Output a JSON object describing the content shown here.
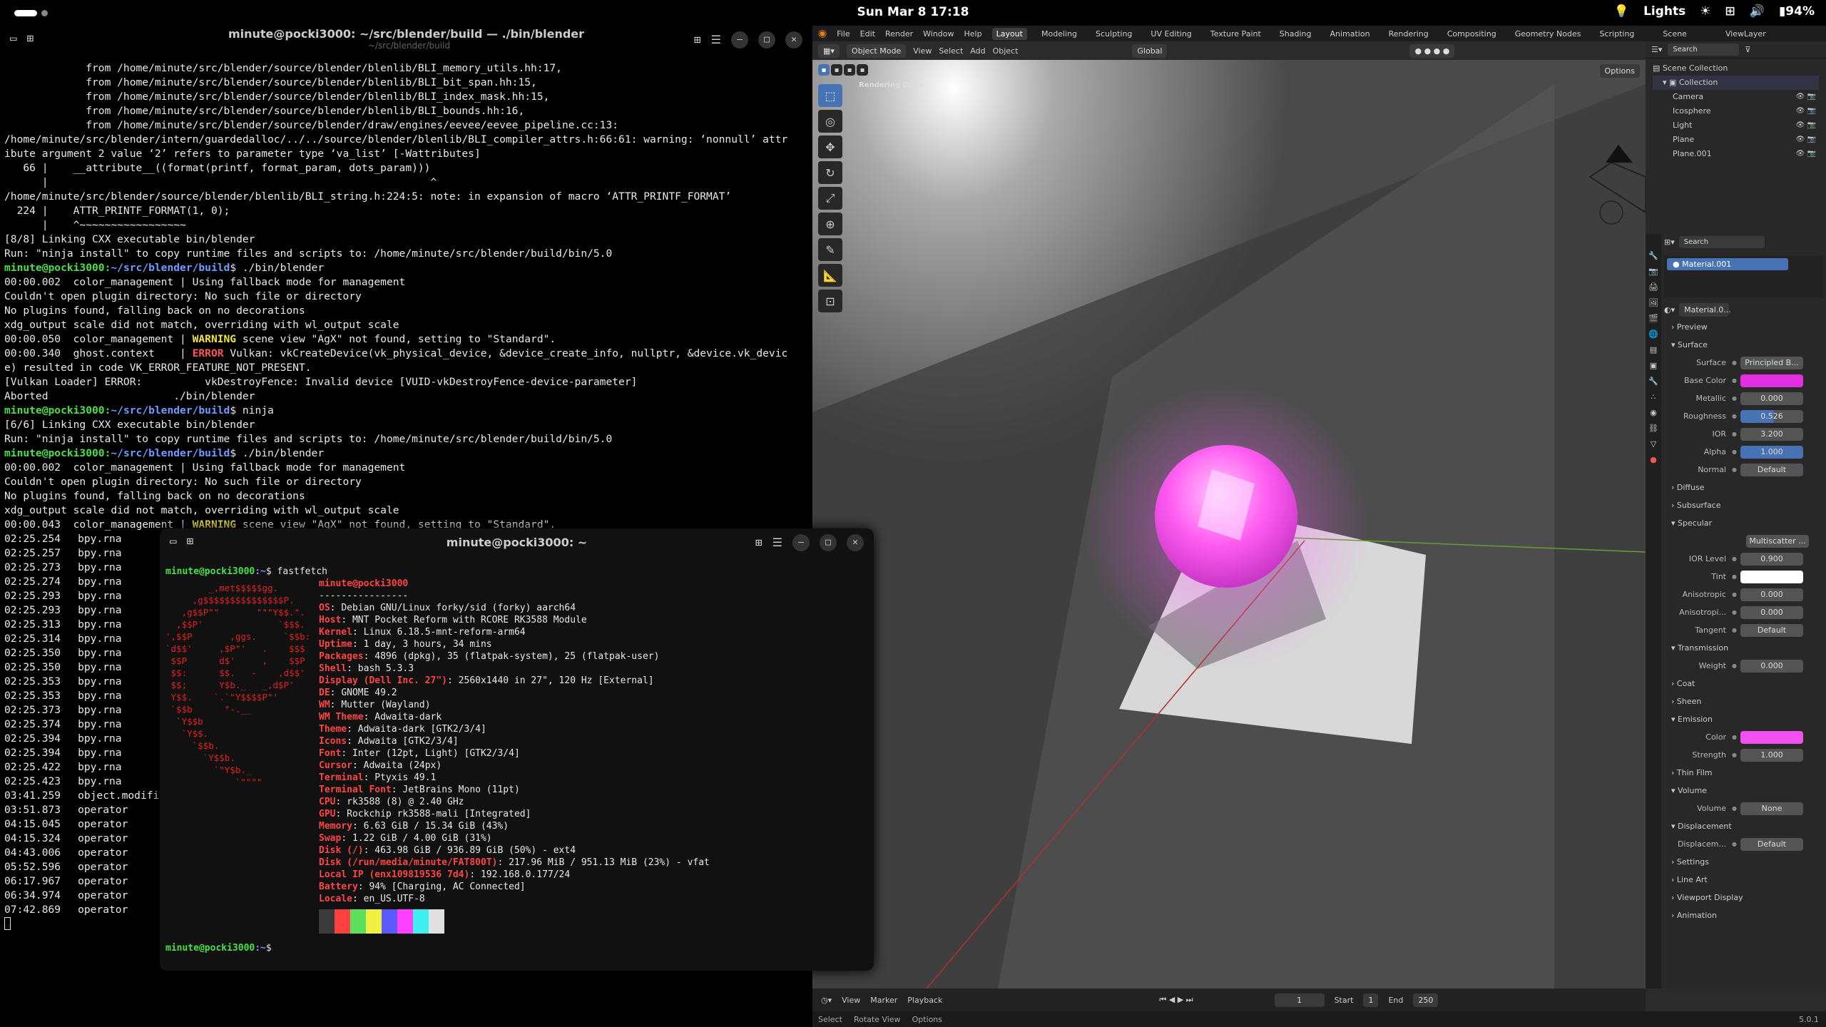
{
  "topbar": {
    "clock": "Sun Mar 8  17:18",
    "lights": "Lights",
    "battery": "94%"
  },
  "back_terminal": {
    "title": "minute@pocki3000: ~/src/blender/build — ./bin/blender",
    "subtitle": "~/src/blender/build",
    "lines": [
      "             from /home/minute/src/blender/source/blender/blenlib/BLI_memory_utils.hh:17,",
      "             from /home/minute/src/blender/source/blender/blenlib/BLI_bit_span.hh:15,",
      "             from /home/minute/src/blender/source/blender/blenlib/BLI_index_mask.hh:15,",
      "             from /home/minute/src/blender/source/blender/blenlib/BLI_bounds.hh:16,",
      "             from /home/minute/src/blender/source/blender/draw/engines/eevee/eevee_pipeline.cc:13:",
      "/home/minute/src/blender/intern/guardedalloc/../../source/blender/blenlib/BLI_compiler_attrs.h:66:61: warning: ‘nonnull’ attr",
      "ibute argument 2 value ‘2’ refers to parameter type ‘va_list’ [-Wattributes]",
      "   66 |    __attribute__((format(printf, format_param, dots_param)))",
      "      |                                                             ^",
      "/home/minute/src/blender/source/blender/blenlib/BLI_string.h:224:5: note: in expansion of macro ‘ATTR_PRINTF_FORMAT’",
      "  224 |    ATTR_PRINTF_FORMAT(1, 0);",
      "      |    ^~~~~~~~~~~~~~~~~~",
      "[8/8] Linking CXX executable bin/blender",
      "Run: \"ninja install\" to copy runtime files and scripts to: /home/minute/src/blender/build/bin/5.0"
    ],
    "session": [
      {
        "t": "prompt",
        "user": "minute@pocki3000",
        "path": "~/src/blender/build",
        "cmd": "$ ./bin/blender"
      },
      {
        "t": "line",
        "text": "00:00.002  color_management | Using fallback mode for management"
      },
      {
        "t": "line",
        "text": "Couldn't open plugin directory: No such file or directory"
      },
      {
        "t": "line",
        "text": "No plugins found, falling back on no decorations"
      },
      {
        "t": "line",
        "text": "xdg_output scale did not match, overriding with wl_output scale"
      },
      {
        "t": "tag",
        "pre": "00:00.050  color_management | ",
        "tag": "WARNING",
        "cls": "ylw",
        "post": " scene view \"AgX\" not found, setting to \"Standard\"."
      },
      {
        "t": "tag",
        "pre": "00:00.340  ghost.context    | ",
        "tag": "ERROR",
        "cls": "red",
        "post": " Vulkan: vkCreateDevice(vk_physical_device, &device_create_info, nullptr, &device.vk_devic"
      },
      {
        "t": "line",
        "text": "e) resulted in code VK_ERROR_FEATURE_NOT_PRESENT."
      },
      {
        "t": "line",
        "text": "[Vulkan Loader] ERROR:          vkDestroyFence: Invalid device [VUID-vkDestroyFence-device-parameter]"
      },
      {
        "t": "line",
        "text": "Aborted                    ./bin/blender"
      },
      {
        "t": "prompt",
        "user": "minute@pocki3000",
        "path": "~/src/blender/build",
        "cmd": "$ ninja"
      },
      {
        "t": "line",
        "text": "[6/6] Linking CXX executable bin/blender"
      },
      {
        "t": "line",
        "text": "Run: \"ninja install\" to copy runtime files and scripts to: /home/minute/src/blender/build/bin/5.0"
      },
      {
        "t": "prompt",
        "user": "minute@pocki3000",
        "path": "~/src/blender/build",
        "cmd": "$ ./bin/blender"
      },
      {
        "t": "line",
        "text": "00:00.002  color_management | Using fallback mode for management"
      },
      {
        "t": "line",
        "text": "Couldn't open plugin directory: No such file or directory"
      },
      {
        "t": "line",
        "text": "No plugins found, falling back on no decorations"
      },
      {
        "t": "line",
        "text": "xdg_output scale did not match, overriding with wl_output scale"
      },
      {
        "t": "tag",
        "pre": "00:00.043  color_management | ",
        "tag": "WARNING",
        "cls": "ylw",
        "post": " scene view \"AgX\" not found, setting to \"Standard\"."
      }
    ],
    "log": [
      [
        "02:25.254",
        "bpy.rna"
      ],
      [
        "02:25.257",
        "bpy.rna"
      ],
      [
        "02:25.273",
        "bpy.rna"
      ],
      [
        "02:25.274",
        "bpy.rna"
      ],
      [
        "02:25.293",
        "bpy.rna"
      ],
      [
        "02:25.293",
        "bpy.rna"
      ],
      [
        "02:25.313",
        "bpy.rna"
      ],
      [
        "02:25.314",
        "bpy.rna"
      ],
      [
        "02:25.350",
        "bpy.rna"
      ],
      [
        "02:25.350",
        "bpy.rna"
      ],
      [
        "02:25.353",
        "bpy.rna"
      ],
      [
        "02:25.353",
        "bpy.rna"
      ],
      [
        "02:25.373",
        "bpy.rna"
      ],
      [
        "02:25.374",
        "bpy.rna"
      ],
      [
        "02:25.394",
        "bpy.rna"
      ],
      [
        "02:25.394",
        "bpy.rna"
      ],
      [
        "02:25.422",
        "bpy.rna"
      ],
      [
        "02:25.423",
        "bpy.rna"
      ],
      [
        "03:41.259",
        "object.modific"
      ],
      [
        "03:51.873",
        "operator"
      ],
      [
        "04:15.045",
        "operator"
      ],
      [
        "04:15.324",
        "operator"
      ],
      [
        "04:43.006",
        "operator"
      ],
      [
        "05:52.596",
        "operator"
      ],
      [
        "06:17.967",
        "operator"
      ],
      [
        "06:34.974",
        "operator"
      ],
      [
        "07:42.869",
        "operator"
      ]
    ]
  },
  "front_terminal": {
    "title": "minute@pocki3000: ~",
    "prompt_user": "minute@pocki3000",
    "prompt_path": ":~",
    "cmd": "$ fastfetch",
    "header": "minute@pocki3000",
    "sep": "----------------",
    "logo": [
      "        _,met$$$$$gg.",
      "     ,g$$$$$$$$$$$$$$$P.",
      "   ,g$$P\"\"       \"\"\"Y$$.\".",
      "  ,$$P'              `$$$.",
      "',$$P       ,ggs.     `$$b:",
      "`d$$'     ,$P\"'   .    $$$",
      " $$P      d$'     ,    $$P",
      " $$:      $$.   -    ,d$$'",
      " $$;      Y$b._   _,d$P'",
      " Y$$.    `.`\"Y$$$$P\"'",
      " `$$b      \"-.__",
      "  `Y$$b",
      "   `Y$$.",
      "     `$$b.",
      "       `Y$$b.",
      "         `\"Y$b._",
      "             `\"\"\"\""
    ],
    "info": [
      {
        "k": "OS",
        "v": "Debian GNU/Linux forky/sid (forky) aarch64"
      },
      {
        "k": "Host",
        "v": "MNT Pocket Reform with RCORE RK3588 Module"
      },
      {
        "k": "Kernel",
        "v": "Linux 6.18.5-mnt-reform-arm64"
      },
      {
        "k": "Uptime",
        "v": "1 day, 3 hours, 34 mins"
      },
      {
        "k": "Packages",
        "v": "4896 (dpkg), 35 (flatpak-system), 25 (flatpak-user)"
      },
      {
        "k": "Shell",
        "v": "bash 5.3.3"
      },
      {
        "k": "Display (Dell Inc. 27\")",
        "v": "2560x1440 in 27\", 120 Hz [External]"
      },
      {
        "k": "DE",
        "v": "GNOME 49.2"
      },
      {
        "k": "WM",
        "v": "Mutter (Wayland)"
      },
      {
        "k": "WM Theme",
        "v": "Adwaita-dark"
      },
      {
        "k": "Theme",
        "v": "Adwaita-dark [GTK2/3/4]"
      },
      {
        "k": "Icons",
        "v": "Adwaita [GTK2/3/4]"
      },
      {
        "k": "Font",
        "v": "Inter (12pt, Light) [GTK2/3/4]"
      },
      {
        "k": "Cursor",
        "v": "Adwaita (24px)"
      },
      {
        "k": "Terminal",
        "v": "Ptyxis 49.1"
      },
      {
        "k": "Terminal Font",
        "v": "JetBrains Mono (11pt)"
      },
      {
        "k": "CPU",
        "v": "rk3588 (8) @ 2.40 GHz"
      },
      {
        "k": "GPU",
        "v": "Rockchip rk3588-mali [Integrated]"
      },
      {
        "k": "Memory",
        "v": "6.63 GiB / 15.34 GiB (43%)"
      },
      {
        "k": "Swap",
        "v": "1.22 GiB / 4.00 GiB (31%)"
      },
      {
        "k": "Disk (/)",
        "v": "463.98 GiB / 936.89 GiB (50%) - ext4"
      },
      {
        "k": "Disk (/run/media/minute/FAT800T)",
        "v": "217.96 MiB / 951.13 MiB (23%) - vfat"
      },
      {
        "k": "Local IP (enx109819536 7d4)",
        "v": "192.168.0.177/24"
      },
      {
        "k": "Battery",
        "v": "94% [Charging, AC Connected]"
      },
      {
        "k": "Locale",
        "v": "en_US.UTF-8"
      }
    ],
    "palette": [
      "#3a3a3a",
      "#ff4040",
      "#5ee05e",
      "#f0f040",
      "#5a5aff",
      "#ff40ff",
      "#40f0f0",
      "#e0e0e0"
    ],
    "end_prompt": "$"
  },
  "blender": {
    "menu": [
      "File",
      "Edit",
      "Render",
      "Window",
      "Help"
    ],
    "workspaces": [
      "Layout",
      "Modeling",
      "Sculpting",
      "UV Editing",
      "Texture Paint",
      "Shading",
      "Animation",
      "Rendering",
      "Compositing",
      "Geometry Nodes",
      "Scripting"
    ],
    "scene": "Scene",
    "viewlayer": "ViewLayer",
    "vp_header": {
      "mode": "Object Mode",
      "view": "View",
      "select": "Select",
      "add": "Add",
      "object": "Object",
      "orient": "Global",
      "options": "Options"
    },
    "vp_label": "Rendering Done",
    "outliner": {
      "search": "Search",
      "root": "Scene Collection",
      "coll": "Collection",
      "items": [
        "Camera",
        "Icosphere",
        "Light",
        "Plane",
        "Plane.001"
      ]
    },
    "props": {
      "search": "Search",
      "material": "Material.001",
      "material_short": "Material.0...",
      "sections": {
        "preview": "Preview",
        "surface": "Surface",
        "diffuse": "Diffuse",
        "subsurface": "Subsurface",
        "specular": "Specular",
        "transmission": "Transmission",
        "coat": "Coat",
        "sheen": "Sheen",
        "emission": "Emission",
        "thinfilm": "Thin Film",
        "volume": "Volume",
        "displacement": "Displacement",
        "settings": "Settings",
        "lineart": "Line Art",
        "viewport": "Viewport Display",
        "animation": "Animation"
      },
      "surface": {
        "label": "Surface",
        "val": "Principled B..."
      },
      "base_color": {
        "label": "Base Color",
        "color": "#e02ee0"
      },
      "metallic": {
        "label": "Metallic",
        "val": "0.000"
      },
      "roughness": {
        "label": "Roughness",
        "val": "0.526",
        "fill": 0.526
      },
      "ior": {
        "label": "IOR",
        "val": "3.200"
      },
      "alpha": {
        "label": "Alpha",
        "val": "1.000"
      },
      "normal": {
        "label": "Normal",
        "val": "Default"
      },
      "multiscatter": "Multiscatter ...",
      "ior_level": {
        "label": "IOR Level",
        "val": "0.900"
      },
      "tint": {
        "label": "Tint",
        "color": "#ffffff"
      },
      "aniso": {
        "label": "Anisotropic",
        "val": "0.000"
      },
      "aniso_rot": {
        "label": "Anisotropi...",
        "val": "0.000"
      },
      "tangent": {
        "label": "Tangent",
        "val": "Default"
      },
      "weight": {
        "label": "Weight",
        "val": "0.000"
      },
      "em_color": {
        "label": "Color",
        "color": "#f050f0"
      },
      "em_strength": {
        "label": "Strength",
        "val": "1.000"
      },
      "vol": {
        "label": "Volume",
        "val": "None"
      },
      "disp": {
        "label": "Displacem...",
        "val": "Default"
      }
    },
    "timeline": {
      "view": "View",
      "marker": "Marker",
      "playback": "Playback",
      "frame": "1",
      "start_label": "Start",
      "start": "1",
      "end_label": "End",
      "end": "250"
    },
    "status": {
      "select": "Select",
      "rotate": "Rotate View",
      "options": "Options",
      "version": "5.0.1"
    }
  }
}
